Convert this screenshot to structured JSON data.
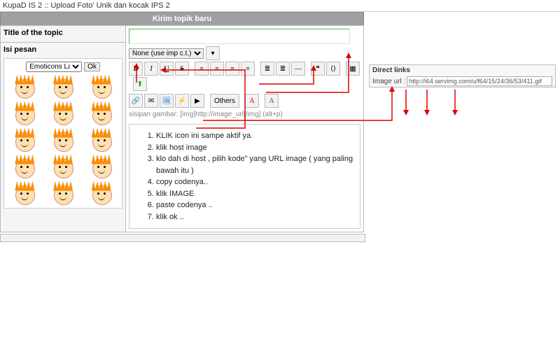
{
  "page": {
    "breadcrumb": "KupaD IS 2 :: Upload Foto' Unik dan kocak IPS 2"
  },
  "form": {
    "section_title": "Kirim topik baru",
    "title_label": "Title of the topic",
    "topic_value": "",
    "font_select_value": "None (use imp c.t.)",
    "content_label": "Isi pesan",
    "hint": "sisipan gambar: [img]http://image_url[/img] (alt+p)",
    "others_label": "Others"
  },
  "toolbar": {
    "bold": "B",
    "italic": "I",
    "underline": "U",
    "strike": "S"
  },
  "emoticon": {
    "select_value": "Emoticons Lain",
    "ok_label": "Ok"
  },
  "instructions": {
    "items": [
      "KLIK icon ini sampe aktif ya.",
      "klik host image",
      "klo dah di host , pilih kode\" yang URL image ( yang paling bawah itu )",
      "copy codenya..",
      "klik IMAGE",
      "paste codenya ..",
      "klik ok .."
    ]
  },
  "direct_links": {
    "header": "Direct links",
    "image_url_label": "Image url :",
    "image_url_value": "http://i64.servimg.com/u/f64/15/24/36/53/411.gif"
  }
}
